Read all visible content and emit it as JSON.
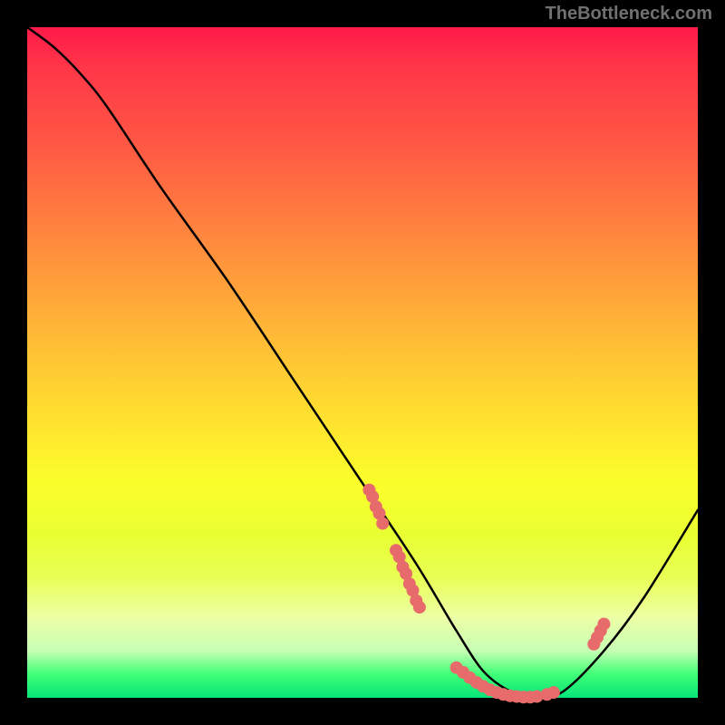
{
  "watermark": "TheBottleneck.com",
  "chart_data": {
    "type": "line",
    "title": "",
    "xlabel": "",
    "ylabel": "",
    "xlim": [
      0,
      100
    ],
    "ylim": [
      0,
      100
    ],
    "grid": false,
    "series": [
      {
        "name": "curve",
        "x": [
          0,
          4,
          8,
          12,
          20,
          30,
          40,
          50,
          58,
          64,
          68,
          72,
          76,
          80,
          86,
          92,
          100
        ],
        "y": [
          100,
          97,
          93,
          88,
          76,
          62,
          47,
          32,
          20,
          10,
          4,
          1,
          0,
          1,
          7,
          15,
          28
        ],
        "color": "#000000"
      }
    ],
    "markers": [
      {
        "name": "cluster-left-upper",
        "color": "#e86b6b",
        "points": [
          [
            51,
            31
          ],
          [
            51.5,
            30
          ],
          [
            52,
            28.5
          ],
          [
            52.5,
            27.5
          ],
          [
            53,
            26
          ]
        ]
      },
      {
        "name": "cluster-left-lower",
        "color": "#e86b6b",
        "points": [
          [
            55,
            22
          ],
          [
            55.5,
            21
          ],
          [
            56,
            19.5
          ],
          [
            56.5,
            18.5
          ],
          [
            57,
            17
          ],
          [
            57.5,
            16
          ],
          [
            58,
            14.5
          ],
          [
            58.5,
            13.5
          ]
        ]
      },
      {
        "name": "cluster-bottom",
        "color": "#e86b6b",
        "points": [
          [
            64,
            4.5
          ],
          [
            65,
            3.8
          ],
          [
            66,
            3
          ],
          [
            67,
            2.3
          ],
          [
            68,
            1.7
          ],
          [
            69,
            1.2
          ],
          [
            70,
            0.8
          ],
          [
            71,
            0.5
          ],
          [
            72,
            0.3
          ],
          [
            73,
            0.2
          ],
          [
            74,
            0.1
          ],
          [
            75,
            0.1
          ],
          [
            76,
            0.2
          ],
          [
            77.5,
            0.5
          ],
          [
            78.5,
            0.8
          ]
        ]
      },
      {
        "name": "cluster-right",
        "color": "#e86b6b",
        "points": [
          [
            84.5,
            8
          ],
          [
            85,
            9
          ],
          [
            85.5,
            10
          ],
          [
            86,
            11
          ]
        ]
      }
    ]
  }
}
